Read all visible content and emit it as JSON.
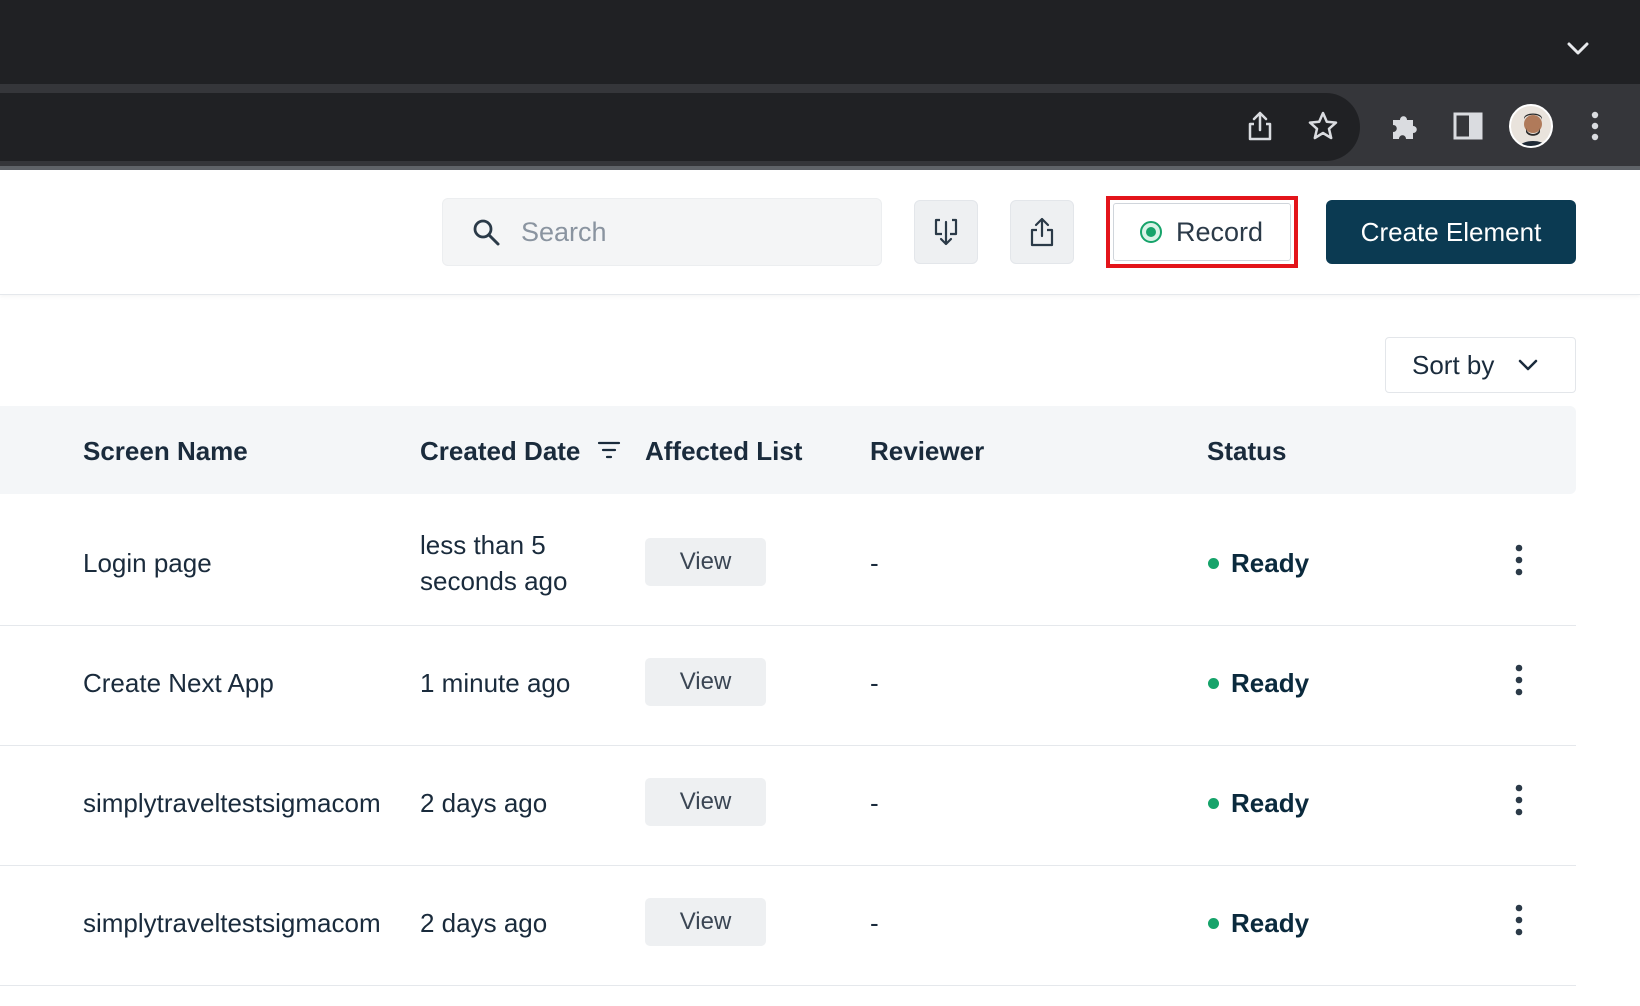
{
  "browser": {
    "icons": [
      "chevron-down-icon",
      "share-icon",
      "star-icon",
      "puzzle-icon",
      "side-panel-icon",
      "avatar",
      "kebab-menu-icon"
    ]
  },
  "header": {
    "search": {
      "placeholder": "Search",
      "value": ""
    },
    "record_label": "Record",
    "create_label": "Create Element",
    "accent_color": "#0b3a52",
    "highlight_color": "#e3141a"
  },
  "sort": {
    "label": "Sort by"
  },
  "table": {
    "columns": {
      "screen_name": "Screen Name",
      "created_date": "Created Date",
      "affected_list": "Affected List",
      "reviewer": "Reviewer",
      "status": "Status"
    },
    "rows": [
      {
        "screen_name": "Login page",
        "created": "less than 5 seconds ago",
        "affected": "View",
        "reviewer": "-",
        "status": "Ready"
      },
      {
        "screen_name": "Create Next App",
        "created": "1 minute ago",
        "affected": "View",
        "reviewer": "-",
        "status": "Ready"
      },
      {
        "screen_name": "simplytraveltestsigmacom",
        "created": "2 days ago",
        "affected": "View",
        "reviewer": "-",
        "status": "Ready"
      },
      {
        "screen_name": "simplytraveltestsigmacom",
        "created": "2 days ago",
        "affected": "View",
        "reviewer": "-",
        "status": "Ready"
      }
    ],
    "status_color": "#16a36a"
  }
}
